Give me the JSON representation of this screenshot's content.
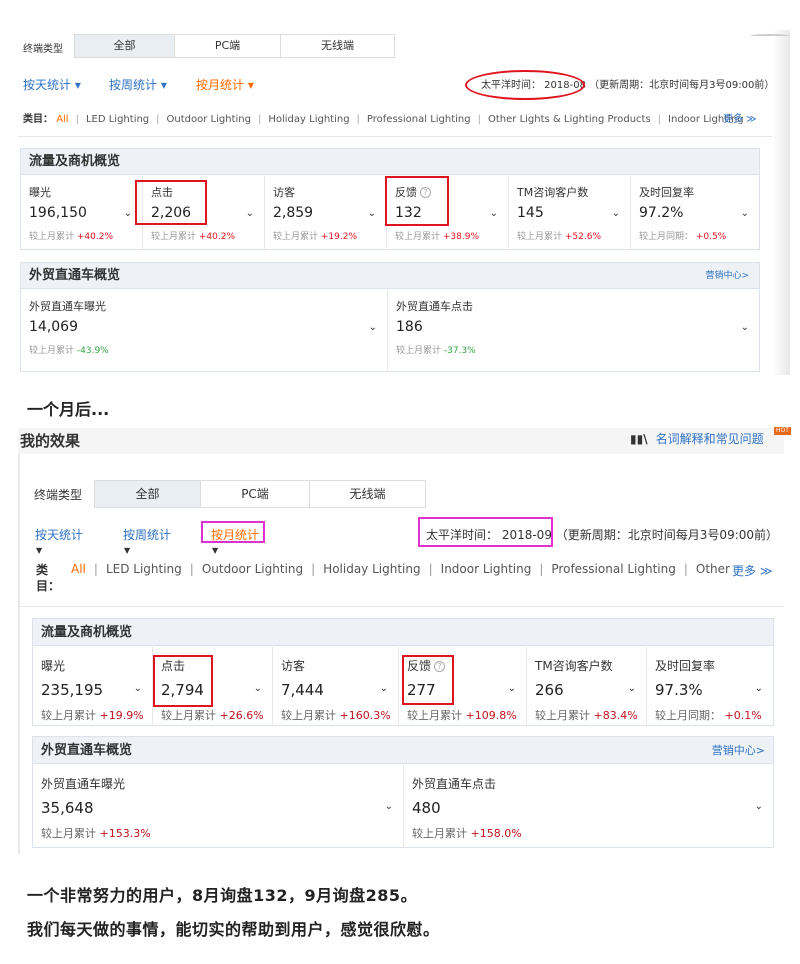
{
  "panel1": {
    "terminal_label": "终端类型",
    "tabs": [
      "全部",
      "PC端",
      "无线端"
    ],
    "stats": [
      "按天统计 ▾",
      "按周统计 ▾",
      "按月统计 ▾"
    ],
    "time_text": "太平洋时间： 2018-08 （更新周期：北京时间每月3号09:00前）",
    "category_label": "类目：",
    "categories": [
      "All",
      "LED Lighting",
      "Outdoor Lighting",
      "Holiday Lighting",
      "Professional Lighting",
      "Other Lights & Lighting Products",
      "Indoor Lighting"
    ],
    "more": "更多 ≫",
    "traffic_title": "流量及商机概览",
    "metrics": [
      {
        "name": "曝光",
        "value": "196,150",
        "cmp_label": "较上月累计",
        "cmp_value": "+40.2%"
      },
      {
        "name": "点击",
        "value": "2,206",
        "cmp_label": "较上月累计",
        "cmp_value": "+40.2%"
      },
      {
        "name": "访客",
        "value": "2,859",
        "cmp_label": "较上月累计",
        "cmp_value": "+19.2%"
      },
      {
        "name": "反馈",
        "value": "132",
        "cmp_label": "较上月累计",
        "cmp_value": "+38.9%"
      },
      {
        "name": "TM咨询客户数",
        "value": "145",
        "cmp_label": "较上月累计",
        "cmp_value": "+52.6%"
      },
      {
        "name": "及时回复率",
        "value": "97.2%",
        "cmp_label": "较上月同期：",
        "cmp_value": "+0.5%"
      }
    ],
    "p4p_title": "外贸直通车概览",
    "p4p_link": "营销中心>",
    "p4p_metrics": [
      {
        "name": "外贸直通车曝光",
        "value": "14,069",
        "cmp_label": "较上月累计",
        "cmp_value": "-43.9%"
      },
      {
        "name": "外贸直通车点击",
        "value": "186",
        "cmp_label": "较上月累计",
        "cmp_value": "-37.3%"
      }
    ]
  },
  "caption_middle": "一个月后...",
  "panel2": {
    "title": "我的效果",
    "help_link": "名词解释和常见问题",
    "hot_badge": "HOT",
    "terminal_label": "终端类型",
    "tabs": [
      "全部",
      "PC端",
      "无线端"
    ],
    "stats": [
      "按天统计",
      "按周统计",
      "按月统计"
    ],
    "time_label": "太平洋时间： 2018-09",
    "time_suffix": "（更新周期：北京时间每月3号09:00前）",
    "category_label": "类目：",
    "categories": [
      "All",
      "LED Lighting",
      "Outdoor Lighting",
      "Holiday Lighting",
      "Indoor Lighting",
      "Professional Lighting",
      "Other"
    ],
    "more": "更多 ≫",
    "traffic_title": "流量及商机概览",
    "metrics": [
      {
        "name": "曝光",
        "value": "235,195",
        "cmp_label": "较上月累计",
        "cmp_value": "+19.9%"
      },
      {
        "name": "点击",
        "value": "2,794",
        "cmp_label": "较上月累计",
        "cmp_value": "+26.6%"
      },
      {
        "name": "访客",
        "value": "7,444",
        "cmp_label": "较上月累计",
        "cmp_value": "+160.3%"
      },
      {
        "name": "反馈",
        "value": "277",
        "cmp_label": "较上月累计",
        "cmp_value": "+109.8%"
      },
      {
        "name": "TM咨询客户数",
        "value": "266",
        "cmp_label": "较上月累计",
        "cmp_value": "+83.4%"
      },
      {
        "name": "及时回复率",
        "value": "97.3%",
        "cmp_label": "较上月同期：",
        "cmp_value": "+0.1%"
      }
    ],
    "p4p_title": "外贸直通车概览",
    "p4p_link": "营销中心>",
    "p4p_metrics": [
      {
        "name": "外贸直通车曝光",
        "value": "35,648",
        "cmp_label": "较上月累计",
        "cmp_value": "+153.3%"
      },
      {
        "name": "外贸直通车点击",
        "value": "480",
        "cmp_label": "较上月累计",
        "cmp_value": "+158.0%"
      }
    ]
  },
  "bottom_line1": "一个非常努力的用户，8月询盘132，9月询盘285。",
  "bottom_line2": "我们每天做的事情，能切实的帮助到用户，感觉很欣慰。",
  "colors": {
    "link": "#2f72c3",
    "active": "#ff6a00",
    "highlight_red": "#e0141e",
    "highlight_magenta": "#e030d0"
  }
}
